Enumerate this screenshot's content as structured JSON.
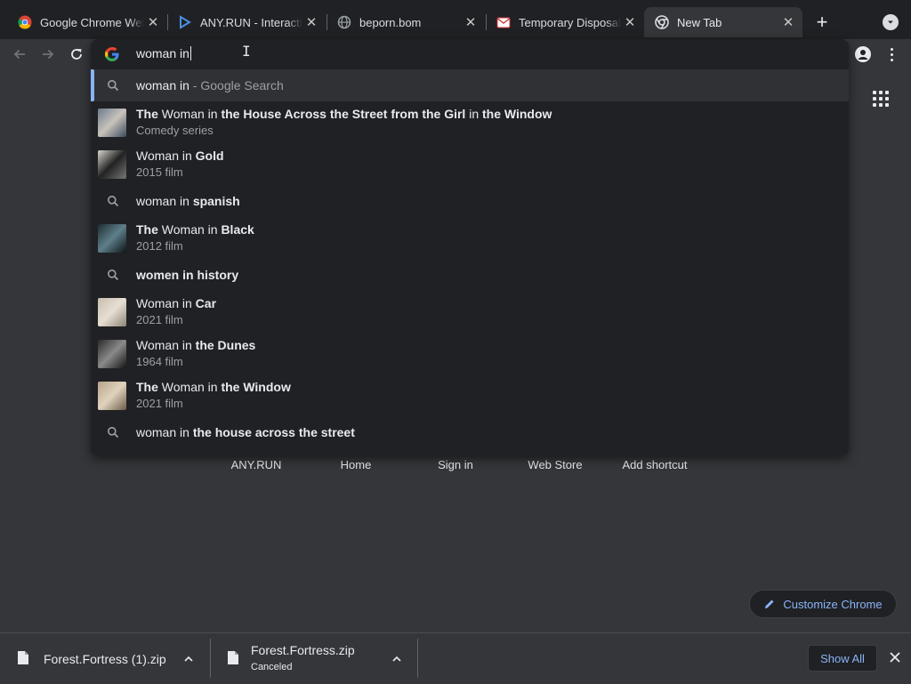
{
  "tabs": [
    {
      "title": "Google Chrome Web Store",
      "icon": "chrome-icon"
    },
    {
      "title": "ANY.RUN - Interactive Online Malware Sandbox",
      "icon": "anyrun-icon"
    },
    {
      "title": "beporn.bom",
      "icon": "globe-icon"
    },
    {
      "title": "Temporary Disposable Email",
      "icon": "mail-icon"
    },
    {
      "title": "New Tab",
      "icon": "chrome-icon",
      "active": true
    }
  ],
  "omnibox": {
    "input_value": "woman in",
    "suggestions": [
      {
        "type": "search",
        "plain": "woman in",
        "bold": "",
        "suffix": " - Google Search",
        "selected": true
      },
      {
        "type": "entity",
        "parts": [
          [
            "The",
            true
          ],
          [
            " Woman ",
            false
          ],
          [
            "in",
            false
          ],
          [
            " the House Across the Street from the Girl ",
            true
          ],
          [
            "in",
            false
          ],
          [
            " the Window",
            true
          ]
        ],
        "subtitle": "Comedy series"
      },
      {
        "type": "entity",
        "parts": [
          [
            "Woman in ",
            false
          ],
          [
            "Gold",
            true
          ]
        ],
        "subtitle": "2015 film"
      },
      {
        "type": "search",
        "plain": "woman in ",
        "bold": "spanish"
      },
      {
        "type": "entity",
        "parts": [
          [
            "The",
            true
          ],
          [
            " Woman in ",
            false
          ],
          [
            "Black",
            true
          ]
        ],
        "subtitle": "2012 film"
      },
      {
        "type": "search",
        "plain": "",
        "bold": "women in history"
      },
      {
        "type": "entity",
        "parts": [
          [
            "Woman in ",
            false
          ],
          [
            "Car",
            true
          ]
        ],
        "subtitle": "2021 film"
      },
      {
        "type": "entity",
        "parts": [
          [
            "Woman in ",
            false
          ],
          [
            "the Dunes",
            true
          ]
        ],
        "subtitle": "1964 film"
      },
      {
        "type": "entity",
        "parts": [
          [
            "The",
            true
          ],
          [
            " Woman in ",
            false
          ],
          [
            "the Window",
            true
          ]
        ],
        "subtitle": "2021 film"
      },
      {
        "type": "search",
        "plain": "woman in ",
        "bold": "the house across the street"
      }
    ]
  },
  "shortcuts": [
    "ANY.RUN",
    "Home",
    "Sign in",
    "Web Store",
    "Add shortcut"
  ],
  "customize_label": "Customize Chrome",
  "downloads": [
    {
      "name": "Forest.Fortress (1).zip",
      "status": ""
    },
    {
      "name": "Forest.Fortress.zip",
      "status": "Canceled"
    }
  ],
  "show_all_label": "Show All",
  "colors": {
    "accent": "#8ab4f8",
    "background": "#35363a",
    "popup": "#202124"
  }
}
